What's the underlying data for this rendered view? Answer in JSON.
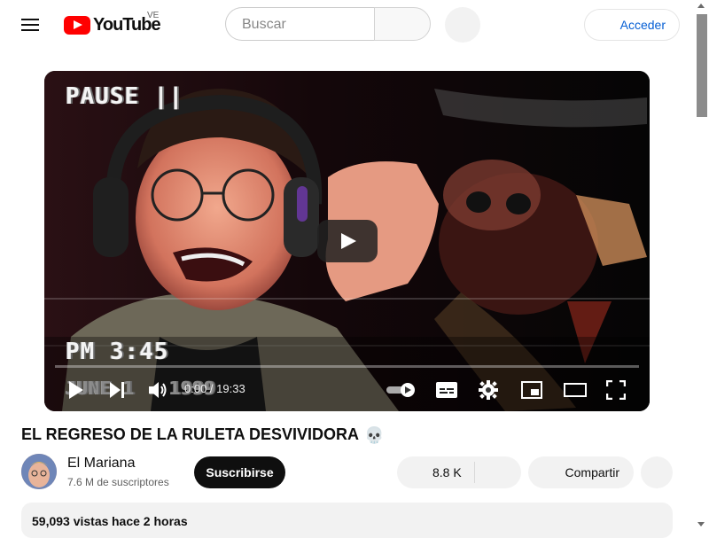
{
  "header": {
    "logo_text": "YouTube",
    "country_code": "VE",
    "search_placeholder": "Buscar",
    "signin_label": "Acceder"
  },
  "player": {
    "overlay_pause": "PAUSE ||",
    "overlay_time": "PM 3:45",
    "overlay_date": "JUNE 1 . 1999",
    "time_display": "0:00 / 19:33",
    "progress_fraction": 0
  },
  "video": {
    "title": "EL REGRESO DE LA RULETA DESVIVIDORA",
    "title_emoji": "💀",
    "channel_name": "El Mariana",
    "subscribers": "7.6 M de suscriptores",
    "subscribe_label": "Suscribirse",
    "likes": "8.8 K",
    "share_label": "Compartir",
    "views": "59,093 vistas",
    "age": "hace 2 horas"
  },
  "colors": {
    "brand_red": "#ff0000",
    "link_blue": "#065fd4",
    "pill_gray": "#f2f2f2"
  }
}
